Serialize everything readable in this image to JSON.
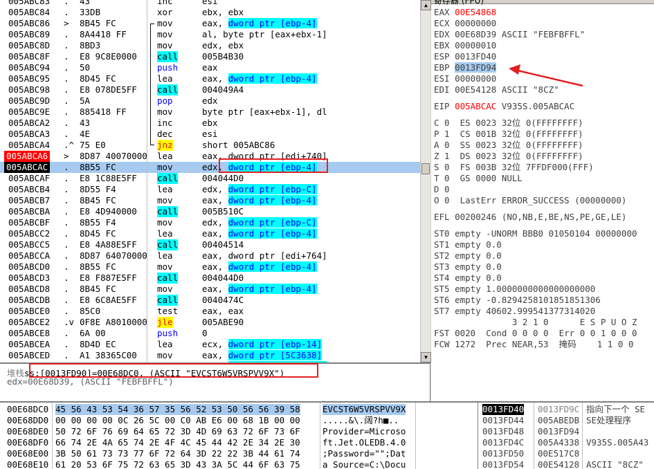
{
  "disasm": [
    {
      "addr": "005ABC83",
      "mark": ".",
      "hex": "43",
      "mn": "inc",
      "op": "esi",
      "mnCls": "",
      "opCls": ""
    },
    {
      "addr": "005ABC84",
      "mark": ".",
      "hex": "33DB",
      "mn": "xor",
      "op": "ebx, ebx"
    },
    {
      "addr": "005ABC86",
      "mark": ">",
      "hex": "8B45 FC",
      "mn": "mov",
      "op": "eax, ",
      "mem": "dword ptr [ebp-4]"
    },
    {
      "addr": "005ABC89",
      "mark": ".",
      "hex": "8A4418 FF",
      "mn": "mov",
      "op": "al, byte ptr [eax+ebx-1]"
    },
    {
      "addr": "005ABC8D",
      "mark": ".",
      "hex": "8BD3",
      "mn": "mov",
      "op": "edx, ebx"
    },
    {
      "addr": "005ABC8F",
      "mark": ".",
      "hex": "E8 9C8E0000",
      "mn": "call",
      "op": "005B4B30",
      "kind": "call"
    },
    {
      "addr": "005ABC94",
      "mark": ".",
      "hex": "50",
      "mn": "push",
      "op": "eax",
      "kind": "push"
    },
    {
      "addr": "005ABC95",
      "mark": ".",
      "hex": "8D45 FC",
      "mn": "lea",
      "op": "eax, ",
      "mem": "dword ptr [ebp-4]"
    },
    {
      "addr": "005ABC98",
      "mark": ".",
      "hex": "E8 078DE5FF",
      "mn": "call",
      "op": "004049A4",
      "kind": "call"
    },
    {
      "addr": "005ABC9D",
      "mark": ".",
      "hex": "5A",
      "mn": "pop",
      "op": "edx",
      "kind": "push"
    },
    {
      "addr": "005ABC9E",
      "mark": ".",
      "hex": "885418 FF",
      "mn": "mov",
      "op": "byte ptr [eax+ebx-1], dl"
    },
    {
      "addr": "005ABCA2",
      "mark": ".",
      "hex": "43",
      "mn": "inc",
      "op": "ebx"
    },
    {
      "addr": "005ABCA3",
      "mark": ".",
      "hex": "4E",
      "mn": "dec",
      "op": "esi"
    },
    {
      "addr": "005ABCA4",
      "mark": ".^",
      "hex": "75 E0",
      "mn": "jnz",
      "op": "short 005ABC86",
      "kind": "jcc"
    },
    {
      "addr": "005ABCA6",
      "mark": ">",
      "hex": "8D87 40070000",
      "mn": "lea",
      "op": "eax, dword ptr [edi+740]",
      "addrStyle": "red"
    },
    {
      "addr": "005ABCAC",
      "mark": ".",
      "hex": "8B55 FC",
      "mn": "mov",
      "op": "edx, ",
      "mem": "dword ptr [ebp-4]",
      "addrStyle": "black",
      "selected": true
    },
    {
      "addr": "005ABCAF",
      "mark": ".",
      "hex": "E8 1C88E5FF",
      "mn": "call",
      "op": "004044D0",
      "kind": "call"
    },
    {
      "addr": "005ABCB4",
      "mark": ".",
      "hex": "8D55 F4",
      "mn": "lea",
      "op": "edx, ",
      "mem": "dword ptr [ebp-C]"
    },
    {
      "addr": "005ABCB7",
      "mark": ".",
      "hex": "8B45 FC",
      "mn": "mov",
      "op": "eax, ",
      "mem": "dword ptr [ebp-4]"
    },
    {
      "addr": "005ABCBA",
      "mark": ".",
      "hex": "E8 4D940000",
      "mn": "call",
      "op": "005B510C",
      "kind": "call"
    },
    {
      "addr": "005ABCBF",
      "mark": ".",
      "hex": "8B55 F4",
      "mn": "mov",
      "op": "edx, ",
      "mem": "dword ptr [ebp-C]"
    },
    {
      "addr": "005ABCC2",
      "mark": ".",
      "hex": "8D45 FC",
      "mn": "lea",
      "op": "eax, ",
      "mem": "dword ptr [ebp-4]"
    },
    {
      "addr": "005ABCC5",
      "mark": ".",
      "hex": "E8 4A88E5FF",
      "mn": "call",
      "op": "00404514",
      "kind": "call"
    },
    {
      "addr": "005ABCCA",
      "mark": ".",
      "hex": "8D87 64070000",
      "mn": "lea",
      "op": "eax, dword ptr [edi+764]"
    },
    {
      "addr": "005ABCD0",
      "mark": ".",
      "hex": "8B55 FC",
      "mn": "mov",
      "op": "eax, ",
      "mem": "dword ptr [ebp-4]"
    },
    {
      "addr": "005ABCD3",
      "mark": ".",
      "hex": "E8 F887E5FF",
      "mn": "call",
      "op": "004044D0",
      "kind": "call"
    },
    {
      "addr": "005ABCD8",
      "mark": ".",
      "hex": "8B45 FC",
      "mn": "mov",
      "op": "eax, ",
      "mem": "dword ptr [ebp-4]"
    },
    {
      "addr": "005ABCDB",
      "mark": ".",
      "hex": "E8 6C8AE5FF",
      "mn": "call",
      "op": "0040474C",
      "kind": "call"
    },
    {
      "addr": "005ABCE0",
      "mark": ".",
      "hex": "85C0",
      "mn": "test",
      "op": "eax, eax"
    },
    {
      "addr": "005ABCE2",
      "mark": ".v",
      "hex": "0F8E A8010000",
      "mn": "jle",
      "op": "005ABE90",
      "kind": "jcc"
    },
    {
      "addr": "005ABCE8",
      "mark": ".",
      "hex": "6A 00",
      "mn": "push",
      "op": "0",
      "kind": "push"
    },
    {
      "addr": "005ABCEA",
      "mark": ".",
      "hex": "8D4D EC",
      "mn": "lea",
      "op": "ecx, ",
      "mem": "dword ptr [ebp-14]"
    },
    {
      "addr": "005ABCED",
      "mark": ".",
      "hex": "A1 38365C00",
      "mn": "mov",
      "op": "eax, ",
      "mem": "dword ptr [5C3638]"
    },
    {
      "addr": "005ABCF2",
      "mark": ".",
      "hex": "8B90 44070000",
      "mn": "mov",
      "op": "edx, ",
      "mem": "dword ptr [eax+740]"
    }
  ],
  "info": {
    "line1_label": "堆栈",
    "line1": "ss:[0013FD90]=00E68DC0, (ASCII \"EVCST6W5VRSPVV9X\")",
    "line2": "edx=00E68D39, (ASCII \"FEBFBFFL\")"
  },
  "registers": {
    "header": "寄存器 (FPU)",
    "gp": [
      {
        "name": "EAX",
        "value": "00E54868",
        "red": true,
        "note": ""
      },
      {
        "name": "ECX",
        "value": "00000000",
        "note": ""
      },
      {
        "name": "EDX",
        "value": "00E68D39",
        "note": "ASCII \"FEBFBFFL\""
      },
      {
        "name": "EBX",
        "value": "00000010",
        "note": ""
      },
      {
        "name": "ESP",
        "value": "0013FD40",
        "note": ""
      },
      {
        "name": "EBP",
        "value": "0013FD94",
        "note": "",
        "highlight": true
      },
      {
        "name": "ESI",
        "value": "00000000",
        "note": ""
      },
      {
        "name": "EDI",
        "value": "00E54128",
        "note": "ASCII \"8CZ\""
      }
    ],
    "eip": {
      "name": "EIP",
      "value": "005ABCAC",
      "note": "V935S.005ABCAC"
    },
    "flags": [
      "C 0  ES 0023 32位 0(FFFFFFFF)",
      "P 1  CS 001B 32位 0(FFFFFFFF)",
      "A 0  SS 0023 32位 0(FFFFFFFF)",
      "Z 1  DS 0023 32位 0(FFFFFFFF)",
      "S 0  FS 003B 32位 7FFDF000(FFF)",
      "T 0  GS 0000 NULL",
      "D 0",
      "O 0  LastErr ERROR_SUCCESS (00000000)"
    ],
    "efl": "EFL 00200246 (NO,NB,E,BE,NS,PE,GE,LE)",
    "fpu": [
      "ST0 empty -UNORM BBB0 01050104 00000000",
      "ST1 empty 0.0",
      "ST2 empty 0.0",
      "ST3 empty 0.0",
      "ST4 empty 0.0",
      "ST5 empty 1.0000000000000000000",
      "ST6 empty -0.8294258101851851306",
      "ST7 empty 40602.999541377314020"
    ],
    "fst_hdr": "               3 2 1 0      E S P U O Z",
    "fst": "FST 0020  Cond 0 0 0 0  Err 0 0 1 0 0 0",
    "fcw": "FCW 1272  Prec NEAR,53  掩码    1 1 0 0"
  },
  "dump": [
    {
      "addr": "00E68DC0",
      "hex": "45 56 43 53 54 36 57 35 56 52 53 50 56 56 39 58",
      "ascii": "EVCST6W5VRSPVV9X",
      "sel": true
    },
    {
      "addr": "00E68DD0",
      "hex": "00 00 00 00 0C 26 5C 00 C0 AB E6 00 68 1B 00 00",
      "ascii": ".....&\\.阔?h■.."
    },
    {
      "addr": "00E68DE0",
      "hex": "50 72 6F 76 69 64 65 72 3D 4D 69 63 72 6F 73 6F",
      "ascii": "Provider=Microso"
    },
    {
      "addr": "00E68DF0",
      "hex": "66 74 2E 4A 65 74 2E 4F 4C 45 44 42 2E 34 2E 30",
      "ascii": "ft.Jet.OLEDB.4.0"
    },
    {
      "addr": "00E68E00",
      "hex": "3B 50 61 73 73 77 6F 72 64 3D 22 22 3B 44 61 74",
      "ascii": ";Password=\"\";Dat"
    },
    {
      "addr": "00E68E10",
      "hex": "61 20 53 6F 75 72 63 65 3D 43 3A 5C 44 6F 63 75",
      "ascii": "a Source=C:\\Docu"
    }
  ],
  "stack": [
    {
      "addr": "0013FD40",
      "value": "0013FD9C",
      "comment": "指向下一个 SE",
      "sel": true
    },
    {
      "addr": "0013FD44",
      "value": "005ABEDB",
      "comment": "SE处理程序"
    },
    {
      "addr": "0013FD48",
      "value": "0013FD94",
      "comment": ""
    },
    {
      "addr": "0013FD4C",
      "value": "005A4338",
      "comment": "V935S.005A43"
    },
    {
      "addr": "0013FD50",
      "value": "00E517C8",
      "comment": ""
    },
    {
      "addr": "0013FD54",
      "value": "00E54128",
      "comment": "ASCII \"8CZ\""
    }
  ]
}
